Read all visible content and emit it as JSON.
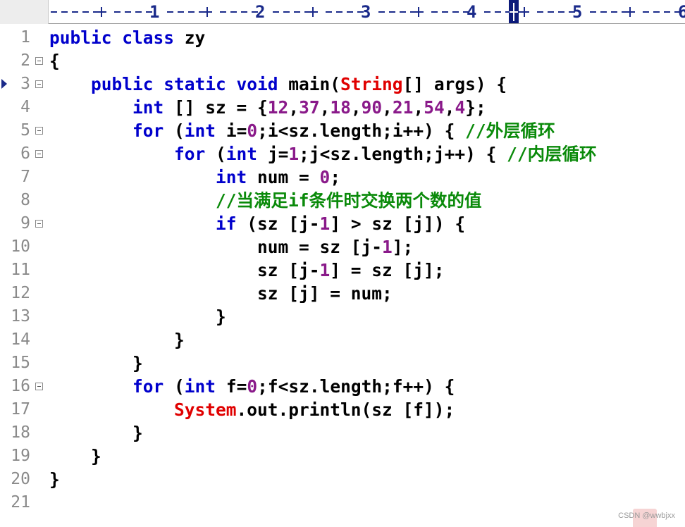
{
  "ruler": {
    "labels": [
      "1",
      "2",
      "3",
      "4",
      "5",
      "6"
    ]
  },
  "gutter": {
    "line_numbers": [
      "1",
      "2",
      "3",
      "4",
      "5",
      "6",
      "7",
      "8",
      "9",
      "10",
      "11",
      "12",
      "13",
      "14",
      "15",
      "16",
      "17",
      "18",
      "19",
      "20",
      "21"
    ],
    "fold_lines": [
      2,
      3,
      5,
      6,
      9,
      16
    ],
    "current_line_marker": 3
  },
  "code": {
    "lines": [
      [
        {
          "t": "public class ",
          "c": "kw"
        },
        {
          "t": "zy",
          "c": "pl"
        }
      ],
      [
        {
          "t": "{",
          "c": "pl"
        }
      ],
      [
        {
          "t": "    ",
          "c": "pl"
        },
        {
          "t": "public static void ",
          "c": "kw"
        },
        {
          "t": "main(",
          "c": "pl"
        },
        {
          "t": "String",
          "c": "str"
        },
        {
          "t": "[] args) {",
          "c": "pl"
        }
      ],
      [
        {
          "t": "        ",
          "c": "pl"
        },
        {
          "t": "int",
          "c": "kw"
        },
        {
          "t": " [] sz = {",
          "c": "pl"
        },
        {
          "t": "12",
          "c": "num"
        },
        {
          "t": ",",
          "c": "pl"
        },
        {
          "t": "37",
          "c": "num"
        },
        {
          "t": ",",
          "c": "pl"
        },
        {
          "t": "18",
          "c": "num"
        },
        {
          "t": ",",
          "c": "pl"
        },
        {
          "t": "90",
          "c": "num"
        },
        {
          "t": ",",
          "c": "pl"
        },
        {
          "t": "21",
          "c": "num"
        },
        {
          "t": ",",
          "c": "pl"
        },
        {
          "t": "54",
          "c": "num"
        },
        {
          "t": ",",
          "c": "pl"
        },
        {
          "t": "4",
          "c": "num"
        },
        {
          "t": "};",
          "c": "pl"
        }
      ],
      [
        {
          "t": "        ",
          "c": "pl"
        },
        {
          "t": "for",
          "c": "kw"
        },
        {
          "t": " (",
          "c": "pl"
        },
        {
          "t": "int",
          "c": "kw"
        },
        {
          "t": " i=",
          "c": "pl"
        },
        {
          "t": "0",
          "c": "num"
        },
        {
          "t": ";i<sz.length;i++) { ",
          "c": "pl"
        },
        {
          "t": "//外层循环",
          "c": "cmt"
        }
      ],
      [
        {
          "t": "            ",
          "c": "pl"
        },
        {
          "t": "for",
          "c": "kw"
        },
        {
          "t": " (",
          "c": "pl"
        },
        {
          "t": "int",
          "c": "kw"
        },
        {
          "t": " j=",
          "c": "pl"
        },
        {
          "t": "1",
          "c": "num"
        },
        {
          "t": ";j<sz.length;j++) { ",
          "c": "pl"
        },
        {
          "t": "//内层循环",
          "c": "cmt"
        }
      ],
      [
        {
          "t": "                ",
          "c": "pl"
        },
        {
          "t": "int",
          "c": "kw"
        },
        {
          "t": " num = ",
          "c": "pl"
        },
        {
          "t": "0",
          "c": "num"
        },
        {
          "t": ";",
          "c": "pl"
        }
      ],
      [
        {
          "t": "                ",
          "c": "pl"
        },
        {
          "t": "//当满足if条件时交换两个数的值",
          "c": "cmt"
        }
      ],
      [
        {
          "t": "                ",
          "c": "pl"
        },
        {
          "t": "if",
          "c": "kw"
        },
        {
          "t": " (sz [j-",
          "c": "pl"
        },
        {
          "t": "1",
          "c": "num"
        },
        {
          "t": "] > sz [j]) {",
          "c": "pl"
        }
      ],
      [
        {
          "t": "                    num = sz [j-",
          "c": "pl"
        },
        {
          "t": "1",
          "c": "num"
        },
        {
          "t": "];",
          "c": "pl"
        }
      ],
      [
        {
          "t": "                    sz [j-",
          "c": "pl"
        },
        {
          "t": "1",
          "c": "num"
        },
        {
          "t": "] = sz [j];",
          "c": "pl"
        }
      ],
      [
        {
          "t": "                    sz [j] = num;",
          "c": "pl"
        }
      ],
      [
        {
          "t": "                }",
          "c": "pl"
        }
      ],
      [
        {
          "t": "            }",
          "c": "pl"
        }
      ],
      [
        {
          "t": "        }",
          "c": "pl"
        }
      ],
      [
        {
          "t": "        ",
          "c": "pl"
        },
        {
          "t": "for",
          "c": "kw"
        },
        {
          "t": " (",
          "c": "pl"
        },
        {
          "t": "int",
          "c": "kw"
        },
        {
          "t": " f=",
          "c": "pl"
        },
        {
          "t": "0",
          "c": "num"
        },
        {
          "t": ";f<sz.length;f++) {",
          "c": "pl"
        }
      ],
      [
        {
          "t": "            ",
          "c": "pl"
        },
        {
          "t": "System",
          "c": "str"
        },
        {
          "t": ".out.println(sz [f]);",
          "c": "pl"
        }
      ],
      [
        {
          "t": "        }",
          "c": "pl"
        }
      ],
      [
        {
          "t": "    }",
          "c": "pl"
        }
      ],
      [
        {
          "t": "}",
          "c": "pl"
        }
      ],
      []
    ]
  },
  "watermark": "CSDN @wwbjxx"
}
